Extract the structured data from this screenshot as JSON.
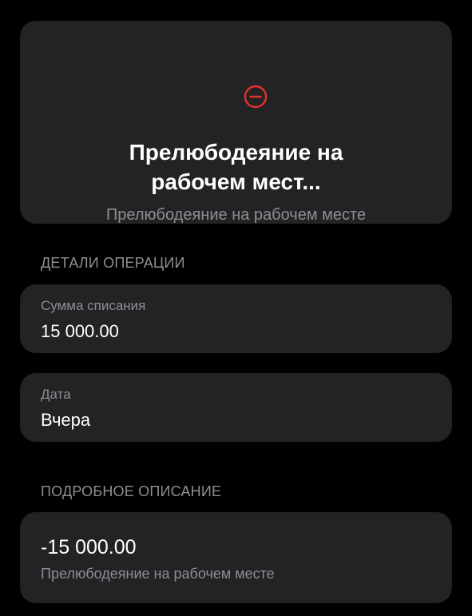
{
  "header": {
    "status_icon": "minus-circle-icon",
    "status_color": "#e5322d",
    "title_line1": "Прелюбодеяние на",
    "title_line2": "рабочем мест...",
    "subtitle": "Прелюбодеяние на рабочем месте"
  },
  "details": {
    "section_title": "ДЕТАЛИ ОПЕРАЦИИ",
    "amount": {
      "label": "Сумма списания",
      "value": "15 000.00"
    },
    "date": {
      "label": "Дата",
      "value": "Вчера"
    }
  },
  "description": {
    "section_title": "ПОДРОБНОЕ ОПИСАНИЕ",
    "amount": "-15 000.00",
    "text": "Прелюбодеяние на рабочем месте"
  },
  "colors": {
    "background": "#000000",
    "card": "#232325",
    "secondary_text": "#8e8e93",
    "primary_text": "#ffffff"
  }
}
